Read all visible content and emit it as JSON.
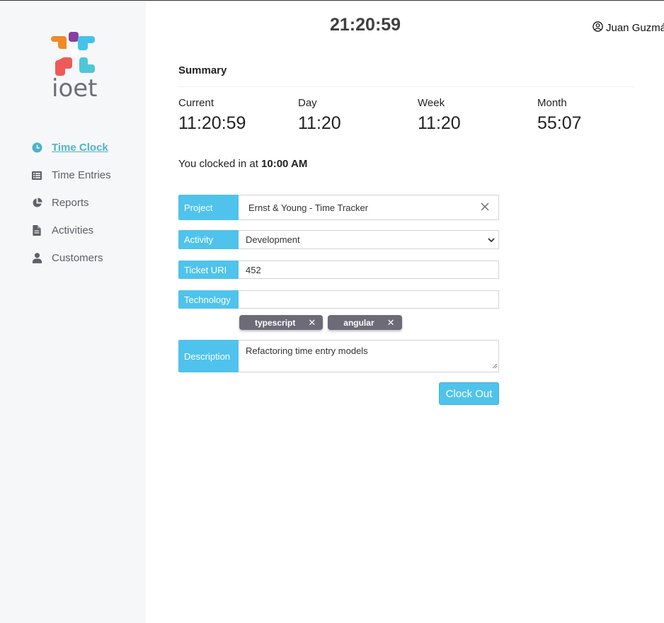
{
  "header": {
    "clock": "21:20:59",
    "user_name": "Juan Guzmán"
  },
  "logo": {
    "text": "ioet"
  },
  "sidebar": {
    "items": [
      {
        "label": "Time Clock",
        "icon": "clock-icon",
        "active": true
      },
      {
        "label": "Time Entries",
        "icon": "list-icon",
        "active": false
      },
      {
        "label": "Reports",
        "icon": "pie-chart-icon",
        "active": false
      },
      {
        "label": "Activities",
        "icon": "file-icon",
        "active": false
      },
      {
        "label": "Customers",
        "icon": "user-icon",
        "active": false
      }
    ]
  },
  "summary": {
    "title": "Summary",
    "stats": [
      {
        "label": "Current",
        "value": "11:20:59"
      },
      {
        "label": "Day",
        "value": "11:20"
      },
      {
        "label": "Week",
        "value": "11:20"
      },
      {
        "label": "Month",
        "value": "55:07"
      }
    ],
    "clocked_in_prefix": "You clocked in at",
    "clocked_in_time": "10:00 AM"
  },
  "form": {
    "project": {
      "label": "Project",
      "value": "Ernst & Young - Time Tracker"
    },
    "activity": {
      "label": "Activity",
      "value": "Development"
    },
    "ticket": {
      "label": "Ticket URI",
      "value": "452"
    },
    "technology": {
      "label": "Technology",
      "value": "",
      "chips": [
        "typescript",
        "angular"
      ]
    },
    "description": {
      "label": "Description",
      "value": "Refactoring time entry models"
    },
    "submit_label": "Clock Out"
  },
  "colors": {
    "accent": "#4fc3ec",
    "active_nav": "#4fb3c8",
    "chip": "#6d6b78",
    "sidebar_bg": "#f6f7f9"
  }
}
